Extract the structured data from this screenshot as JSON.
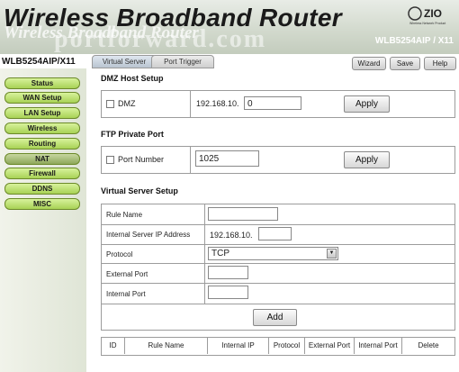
{
  "header": {
    "title": "Wireless Broadband Router",
    "title_reflection": "Wireless Broadband Router",
    "watermark": "portforward.com",
    "logo": {
      "brand": "ZIO",
      "tagline": "Wireless Network Product"
    },
    "model_right": "WLB5254AIP / X11"
  },
  "model_left": "WLB5254AIP/X11",
  "tabs": [
    {
      "label": "Virtual Server",
      "active": true
    },
    {
      "label": "Port Trigger",
      "active": false
    }
  ],
  "top_buttons": {
    "wizard": "Wizard",
    "save": "Save",
    "help": "Help"
  },
  "sidebar": {
    "items": [
      {
        "label": "Status"
      },
      {
        "label": "WAN Setup"
      },
      {
        "label": "LAN Setup"
      },
      {
        "label": "Wireless"
      },
      {
        "label": "Routing"
      },
      {
        "label": "NAT",
        "active": true
      },
      {
        "label": "Firewall"
      },
      {
        "label": "DDNS"
      },
      {
        "label": "MISC"
      }
    ]
  },
  "dmz": {
    "title": "DMZ Host Setup",
    "checkbox_label": "DMZ",
    "ip_prefix": "192.168.10.",
    "ip_value": "0",
    "apply": "Apply"
  },
  "ftp": {
    "title": "FTP Private Port",
    "checkbox_label": "Port Number",
    "port_value": "1025",
    "apply": "Apply"
  },
  "virtual_server": {
    "title": "Virtual Server Setup",
    "rule_name_label": "Rule Name",
    "ip_label": "Internal Server IP Address",
    "ip_prefix": "192.168.10.",
    "protocol_label": "Protocol",
    "protocol_value": "TCP",
    "external_port_label": "External Port",
    "internal_port_label": "Internal Port",
    "add": "Add",
    "table_headers": [
      "ID",
      "Rule Name",
      "Internal IP",
      "Protocol",
      "External Port",
      "Internal Port",
      "Delete"
    ]
  },
  "colors": {
    "nav_green": "#a8d155",
    "header_bg": "#d3dace"
  }
}
